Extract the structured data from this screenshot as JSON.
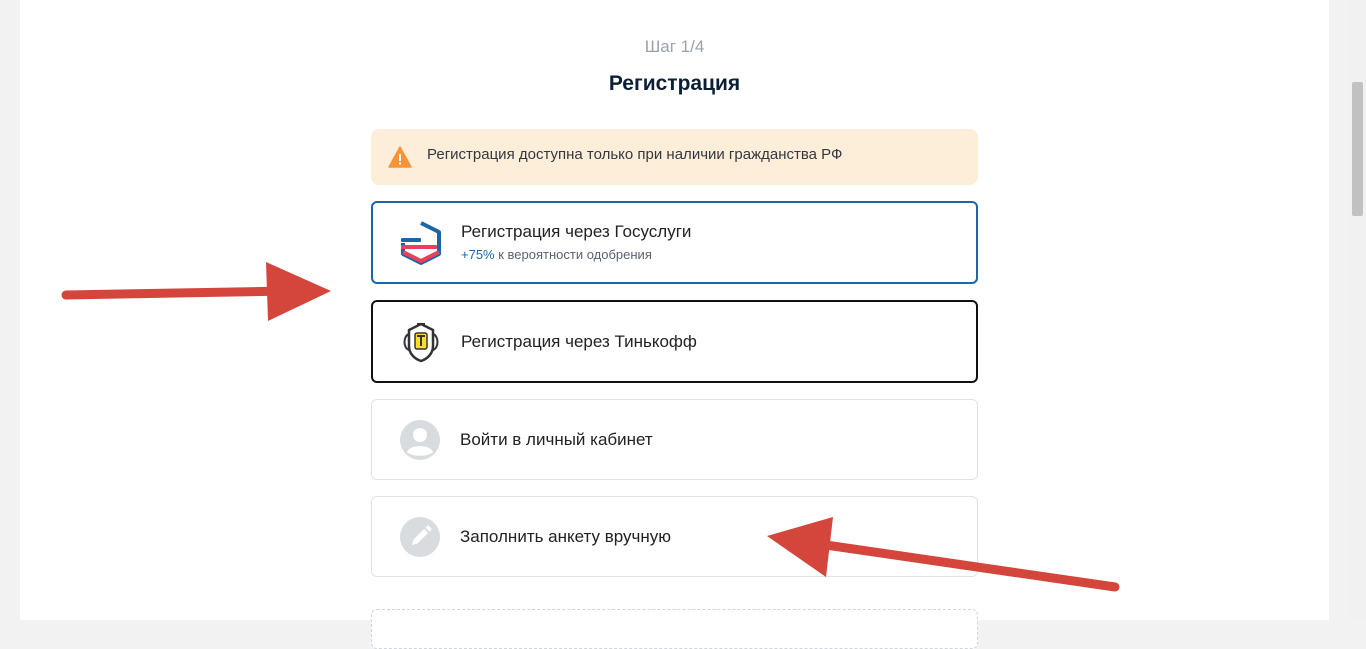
{
  "step": "Шаг 1/4",
  "title": "Регистрация",
  "notice": {
    "icon": "warning-icon",
    "text": "Регистрация доступна только при наличии гражданства РФ"
  },
  "options": {
    "gosuslugi": {
      "icon": "gosuslugi-logo-icon",
      "label": "Регистрация через Госуслуги",
      "sub_accent": "+75%",
      "sub_text": " к вероятности одобрения"
    },
    "tinkoff": {
      "icon": "tinkoff-logo-icon",
      "label": "Регистрация через Тинькофф"
    },
    "login": {
      "icon": "user-avatar-icon",
      "label": "Войти в личный кабинет"
    },
    "manual": {
      "icon": "pencil-icon",
      "label": "Заполнить анкету вручную"
    }
  },
  "colors": {
    "accent_blue": "#1a66a8",
    "notice_bg": "#fdeed9",
    "warning": "#f7943a",
    "annotation_arrow": "#d4463b"
  }
}
